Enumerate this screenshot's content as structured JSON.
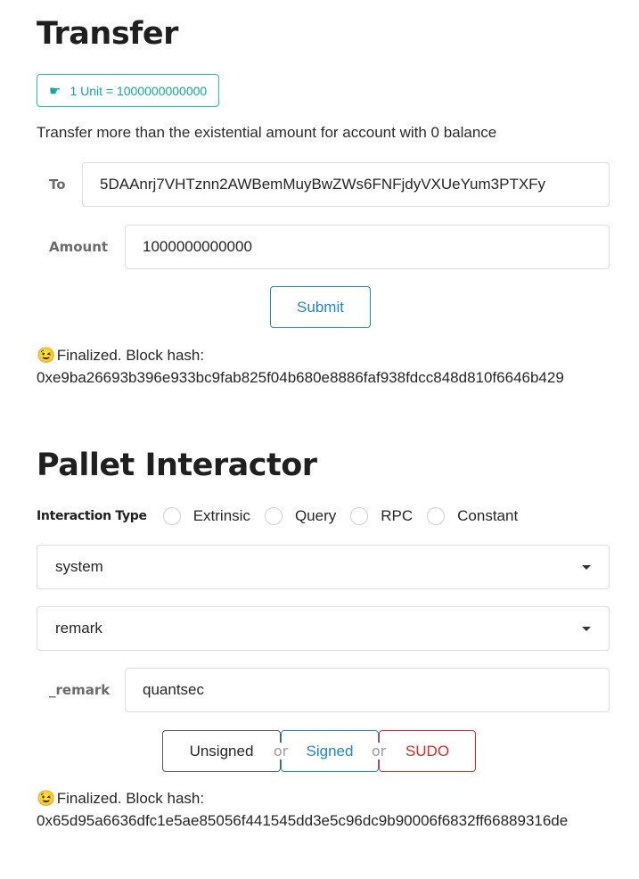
{
  "transfer": {
    "title": "Transfer",
    "unit_label": "1 Unit = 1000000000000",
    "description": "Transfer more than the existential amount for account with 0 balance",
    "to_label": "To",
    "to_value": "5DAAnrj7VHTznn2AWBemMuyBwZWs6FNFjdyVXUeYum3PTXFy",
    "amount_label": "Amount",
    "amount_value": "1000000000000",
    "submit_label": "Submit",
    "status_emoji": "😉",
    "status_text": "Finalized. Block hash:",
    "status_hash": "0xe9ba26693b396e933bc9fab825f04b680e8886faf938fdcc848d810f6646b429"
  },
  "pallet": {
    "title": "Pallet Interactor",
    "interaction_label": "Interaction Type",
    "interaction_options": [
      "Extrinsic",
      "Query",
      "RPC",
      "Constant"
    ],
    "pallet_select": "system",
    "callable_select": "remark",
    "param_label": "_remark",
    "param_value": "quantsec",
    "unsigned_label": "Unsigned",
    "or_label": "or",
    "signed_label": "Signed",
    "sudo_label": "SUDO",
    "status_emoji": "😉",
    "status_text": "Finalized. Block hash:",
    "status_hash": "0x65d95a6636dfc1e5ae85056f441545dd3e5c96dc9b90006f6832ff66889316de"
  },
  "icons": {
    "unit_icon": "hand-point-right-icon",
    "dropdown_icon": "caret-down-icon"
  },
  "colors": {
    "teal_accent": "#14a899",
    "blue_accent": "#2185d0",
    "red_accent": "#db2828"
  }
}
